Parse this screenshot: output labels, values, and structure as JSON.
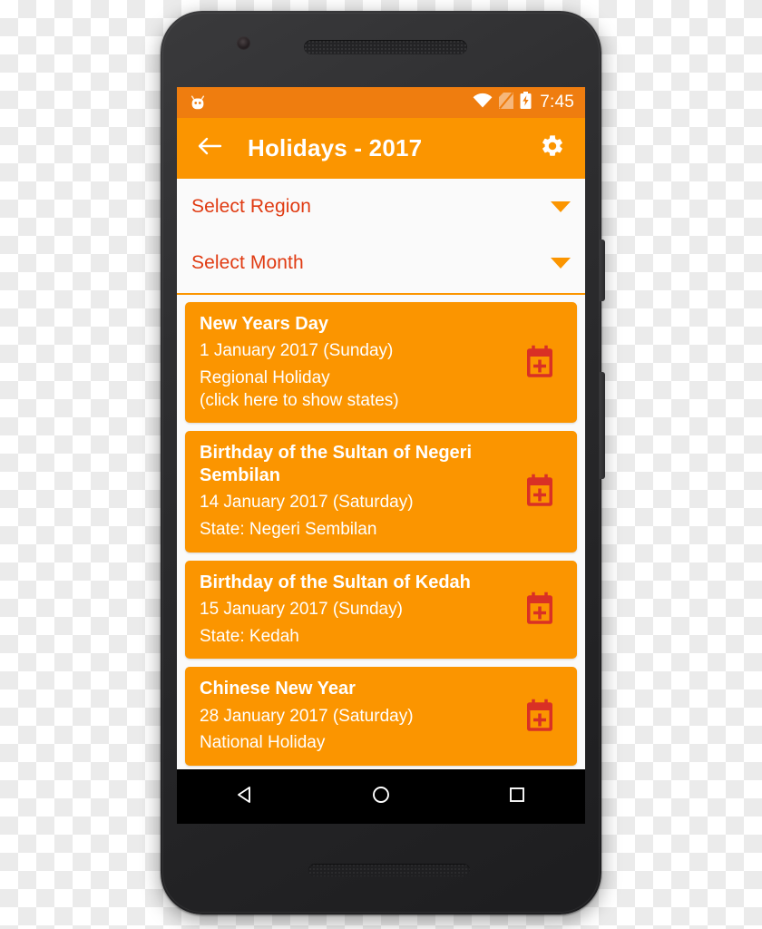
{
  "device": {
    "front_camera": "front-camera",
    "earpiece": "earpiece-speaker",
    "bottom_speaker": "bottom-speaker",
    "power_button": "power-button",
    "volume_button": "volume-button"
  },
  "status_bar": {
    "left_icon": "android-head-icon",
    "icons": [
      "wifi-icon",
      "no-sim-icon",
      "battery-charging-icon"
    ],
    "time": "7:45",
    "background": "#ef7d0f"
  },
  "app_bar": {
    "back_icon": "arrow-back-icon",
    "title": "Holidays - 2017",
    "settings_icon": "gear-icon",
    "background": "#fb9500",
    "text_color": "#ffffff"
  },
  "filters": {
    "accent_color": "#e03b12",
    "caret_color": "#fb9500",
    "items": [
      {
        "label": "Select Region",
        "caret": "chevron-down-icon"
      },
      {
        "label": "Select Month",
        "caret": "chevron-down-icon"
      }
    ]
  },
  "holidays": {
    "card_color": "#fb9500",
    "icon_color": "#d93025",
    "items": [
      {
        "name": "New Years Day",
        "date": "1 January 2017 (Sunday)",
        "meta": "Regional Holiday\n(click here to show states)",
        "icon": "calendar-add-icon"
      },
      {
        "name": "Birthday of the Sultan of Negeri Sembilan",
        "date": "14 January 2017 (Saturday)",
        "meta": "State: Negeri Sembilan",
        "icon": "calendar-add-icon"
      },
      {
        "name": "Birthday of the Sultan of Kedah",
        "date": "15 January 2017 (Sunday)",
        "meta": "State: Kedah",
        "icon": "calendar-add-icon"
      },
      {
        "name": "Chinese New Year",
        "date": "28 January 2017 (Saturday)",
        "meta": "National Holiday",
        "icon": "calendar-add-icon"
      }
    ]
  },
  "nav_bar": {
    "background": "#000000",
    "buttons": [
      "back-triangle-icon",
      "home-circle-icon",
      "recents-square-icon"
    ]
  }
}
